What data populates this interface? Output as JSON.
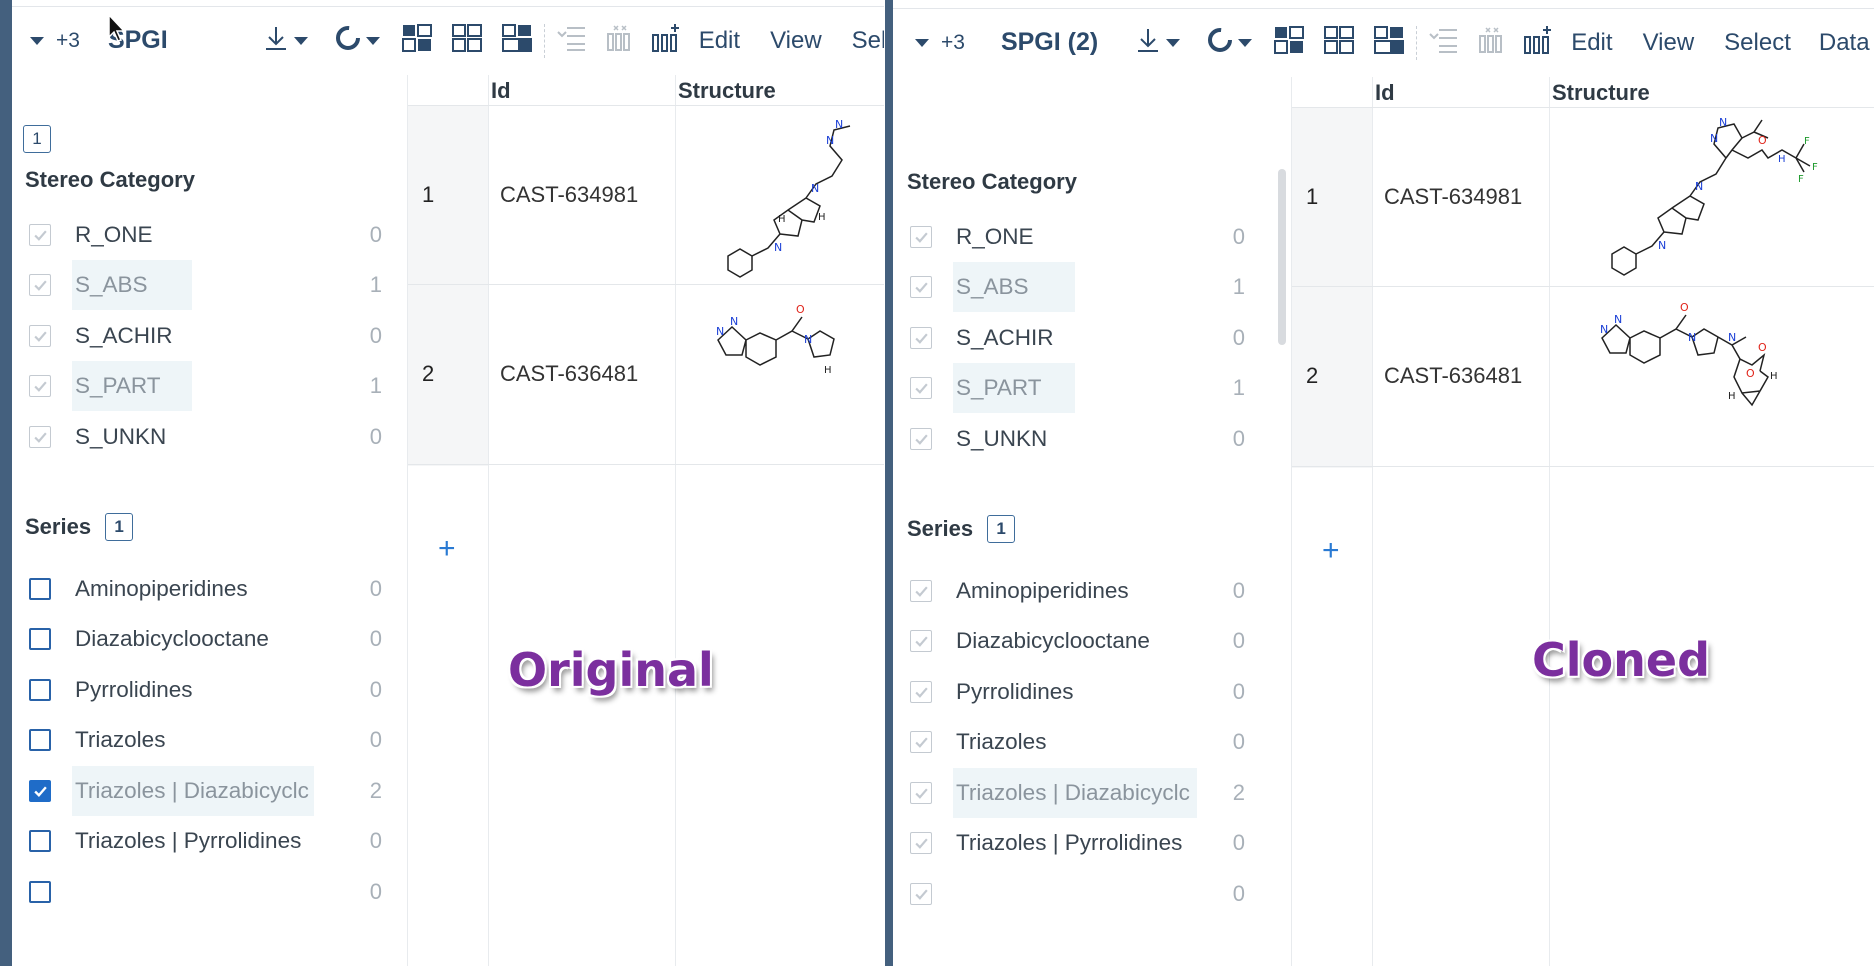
{
  "panels": [
    {
      "tag": "Original",
      "toolbar": {
        "plus_count": "+3",
        "title": "SPGI",
        "menus": [
          "Edit",
          "View",
          "Sele"
        ]
      },
      "stereo": {
        "badge": "1",
        "title": "Stereo Category",
        "items": [
          {
            "label": "R_ONE",
            "count": "0"
          },
          {
            "label": "S_ABS",
            "count": "1"
          },
          {
            "label": "S_ACHIR",
            "count": "0"
          },
          {
            "label": "S_PART",
            "count": "1"
          },
          {
            "label": "S_UNKN",
            "count": "0"
          }
        ]
      },
      "series": {
        "title": "Series",
        "badge": "1",
        "items": [
          {
            "label": "Aminopiperidines",
            "count": "0",
            "state": "unchecked"
          },
          {
            "label": "Diazabicyclooctane",
            "count": "0",
            "state": "unchecked"
          },
          {
            "label": "Pyrrolidines",
            "count": "0",
            "state": "unchecked"
          },
          {
            "label": "Triazoles",
            "count": "0",
            "state": "unchecked"
          },
          {
            "label": "Triazoles | Diazabicyclc",
            "count": "2",
            "state": "checked"
          },
          {
            "label": "Triazoles | Pyrrolidines",
            "count": "0",
            "state": "unchecked"
          },
          {
            "label": "",
            "count": "0",
            "state": "unchecked"
          }
        ]
      },
      "grid": {
        "headers": [
          "Id",
          "Structure"
        ],
        "rows": [
          {
            "num": "1",
            "id": "CAST-634981"
          },
          {
            "num": "2",
            "id": "CAST-636481"
          }
        ],
        "add": "+"
      }
    },
    {
      "tag": "Cloned",
      "toolbar": {
        "plus_count": "+3",
        "title": "SPGI (2)",
        "menus": [
          "Edit",
          "View",
          "Select",
          "Data"
        ]
      },
      "stereo": {
        "title": "Stereo Category",
        "items": [
          {
            "label": "R_ONE",
            "count": "0"
          },
          {
            "label": "S_ABS",
            "count": "1"
          },
          {
            "label": "S_ACHIR",
            "count": "0"
          },
          {
            "label": "S_PART",
            "count": "1"
          },
          {
            "label": "S_UNKN",
            "count": "0"
          }
        ]
      },
      "series": {
        "title": "Series",
        "badge": "1",
        "items": [
          {
            "label": "Aminopiperidines",
            "count": "0",
            "state": "gray"
          },
          {
            "label": "Diazabicyclooctane",
            "count": "0",
            "state": "gray"
          },
          {
            "label": "Pyrrolidines",
            "count": "0",
            "state": "gray"
          },
          {
            "label": "Triazoles",
            "count": "0",
            "state": "gray"
          },
          {
            "label": "Triazoles | Diazabicyclc",
            "count": "2",
            "state": "gray"
          },
          {
            "label": "Triazoles | Pyrrolidines",
            "count": "0",
            "state": "gray"
          },
          {
            "label": "",
            "count": "0",
            "state": "gray"
          }
        ]
      },
      "grid": {
        "headers": [
          "Id",
          "Structure"
        ],
        "rows": [
          {
            "num": "1",
            "id": "CAST-634981"
          },
          {
            "num": "2",
            "id": "CAST-636481"
          }
        ],
        "add": "+"
      }
    }
  ],
  "colors": {
    "accent": "#2c4a6b",
    "check_blue": "#1f6cc8",
    "tag_purple": "#7b2f9e",
    "frame": "#44607e"
  },
  "icons": [
    "download-icon",
    "refresh-icon",
    "layout-grid-icon",
    "layout-split-icon",
    "layout-panels-icon",
    "add-column-icon",
    "remove-rows-icon",
    "insert-column-icon",
    "mouse-pointer-icon"
  ]
}
